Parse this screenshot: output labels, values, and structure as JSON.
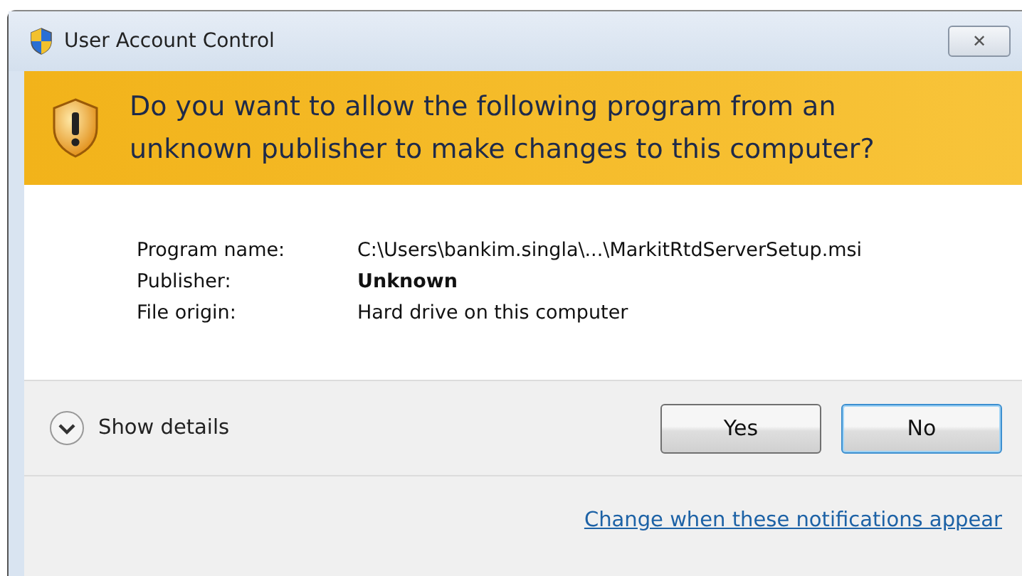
{
  "window": {
    "title": "User Account Control",
    "close_label": "✕"
  },
  "header": {
    "message": "Do you want to allow the following program from an unknown publisher to make changes to this computer?"
  },
  "details": [
    {
      "label": "Program name:",
      "value": "C:\\Users\\bankim.singla\\...\\MarkitRtdServerSetup.msi",
      "bold": false
    },
    {
      "label": "Publisher:",
      "value": "Unknown",
      "bold": true
    },
    {
      "label": "File origin:",
      "value": "Hard drive on this computer",
      "bold": false
    }
  ],
  "show_details": {
    "label": "Show details",
    "expanded": false
  },
  "buttons": [
    {
      "label": "Yes",
      "default": false
    },
    {
      "label": "No",
      "default": true
    }
  ],
  "link": "Change when these notifications appear"
}
